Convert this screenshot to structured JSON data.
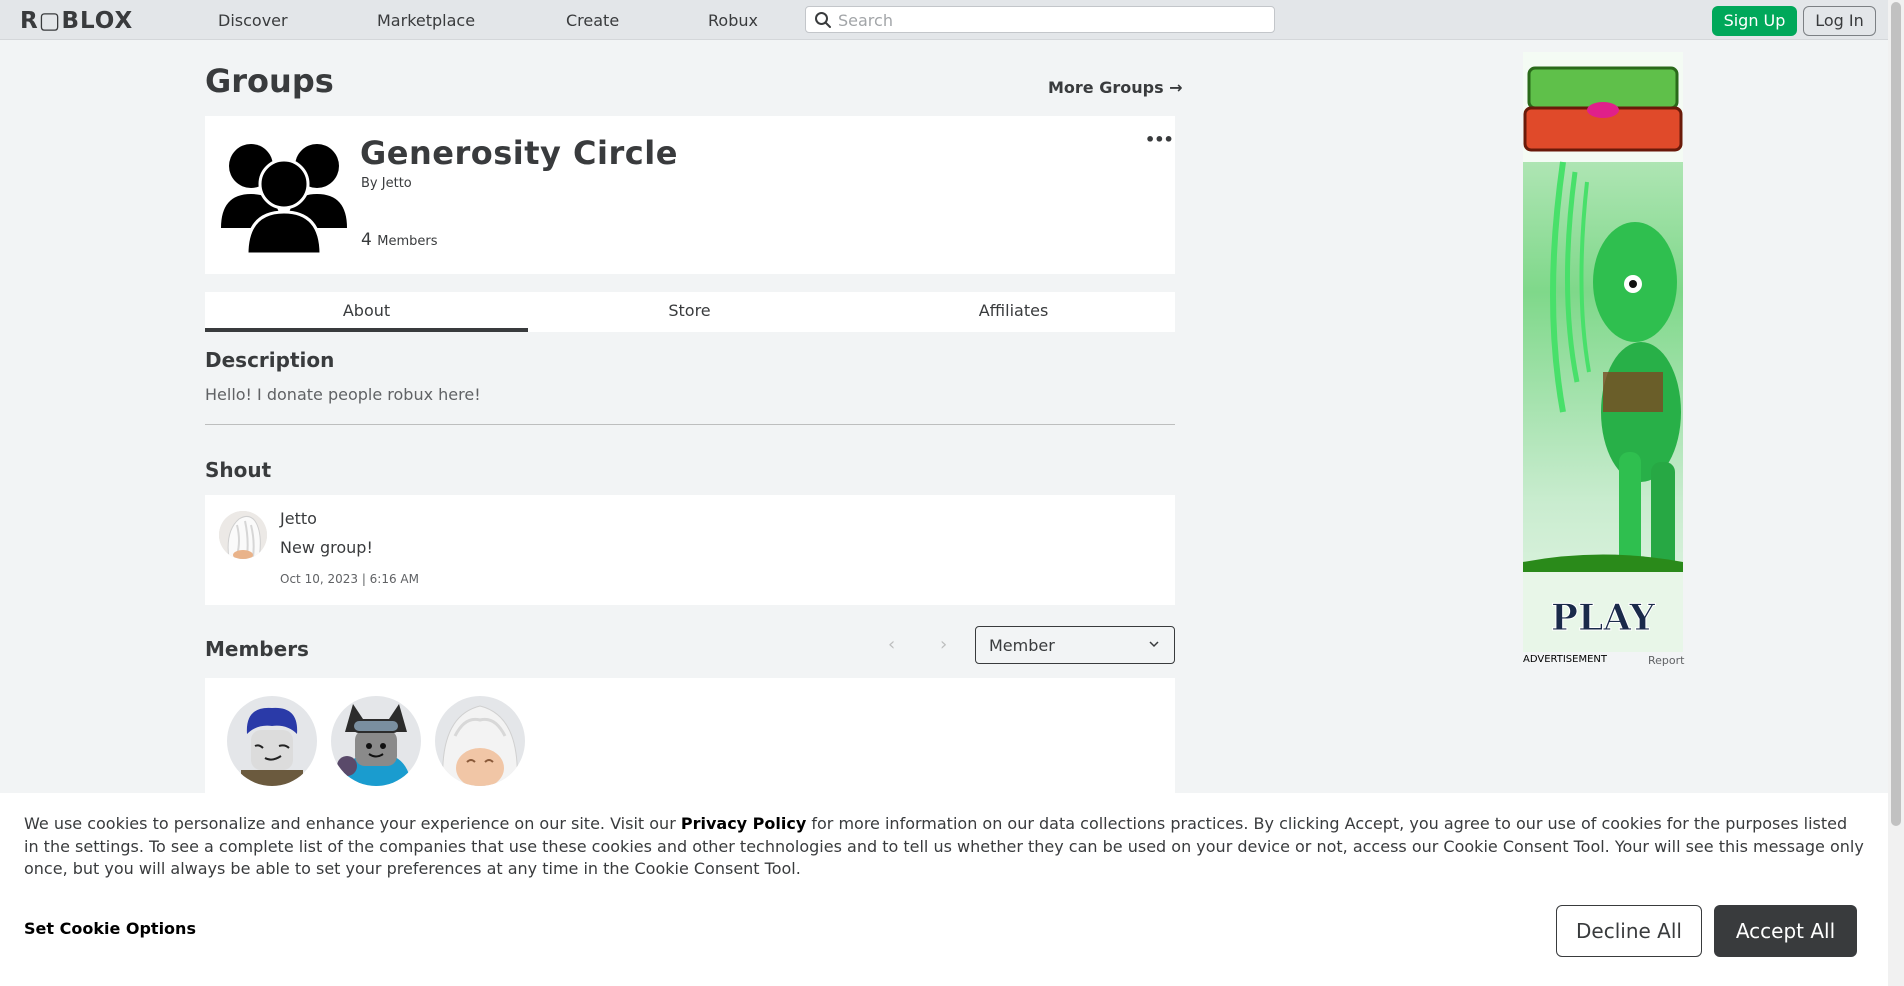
{
  "nav": {
    "logo": "R▢BLOX",
    "links": [
      "Discover",
      "Marketplace",
      "Create",
      "Robux"
    ],
    "search_placeholder": "Search",
    "signup_label": "Sign Up",
    "login_label": "Log In"
  },
  "page": {
    "title": "Groups",
    "more_groups_label": "More Groups →"
  },
  "group": {
    "name": "Generosity Circle",
    "by_label": "By",
    "owner": "Jetto",
    "member_count": "4",
    "members_label": "Members",
    "more_menu": "•••"
  },
  "tabs": [
    "About",
    "Store",
    "Affiliates"
  ],
  "description": {
    "title": "Description",
    "text": "Hello! I donate people robux here!"
  },
  "shout": {
    "title": "Shout",
    "author": "Jetto",
    "body": "New group!",
    "date": "Oct 10, 2023 | 6:16 AM"
  },
  "members": {
    "title": "Members",
    "prev": "‹",
    "next": "›",
    "role_selected": "Member"
  },
  "ad": {
    "label": "ADVERTISEMENT",
    "report": "Report"
  },
  "cookie": {
    "text_before": "We use cookies to personalize and enhance your experience on our site. Visit our ",
    "privacy_link": "Privacy Policy",
    "text_after": " for more information on our data collections practices. By clicking Accept, you agree to our use of cookies for the purposes listed in the settings. To see a complete list of the companies that use these cookies and other technologies and to tell us whether they can be used on your device or not, access our Cookie Consent Tool. Your will see this message only once, but you will always be able to set your preferences at any time in the Cookie Consent Tool.",
    "set_options": "Set Cookie Options",
    "decline": "Decline All",
    "accept": "Accept All"
  },
  "colors": {
    "signup_green": "#00a85a",
    "dark": "#393b3d",
    "background": "#f2f4f5"
  }
}
